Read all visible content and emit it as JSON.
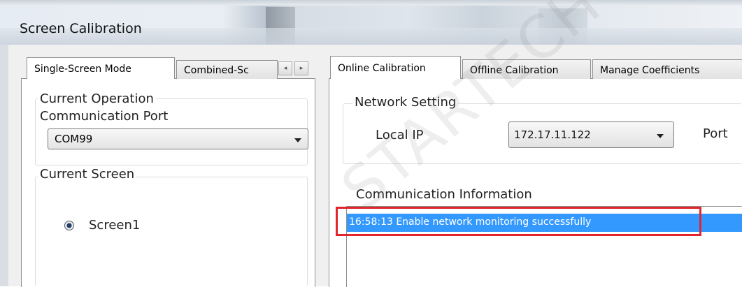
{
  "window": {
    "title": "Screen Calibration"
  },
  "left_tabs": [
    {
      "label": "Single-Screen Mode",
      "selected": true
    },
    {
      "label": "Combined-Sc",
      "selected": false
    }
  ],
  "tab_scroll": {
    "left_icon": "chevron-left-icon",
    "right_icon": "chevron-right-icon",
    "left_glyph": "◂",
    "right_glyph": "▸"
  },
  "current_operation": {
    "label_line1": "Current Operation",
    "label_line2": "Communication Port",
    "port_value": "COM99"
  },
  "current_screen": {
    "label": "Current Screen",
    "radio_label": "Screen1",
    "radio_selected": true
  },
  "right_tabs": [
    {
      "label": "Online Calibration",
      "selected": true
    },
    {
      "label": "Offline Calibration",
      "selected": false
    },
    {
      "label": "Manage Coefficients",
      "selected": false
    }
  ],
  "network_setting": {
    "label": "Network Setting",
    "local_ip_label": "Local IP",
    "local_ip_value": "172.17.11.122",
    "port_label": "Port"
  },
  "communication_info": {
    "label": "Communication Information",
    "messages": [
      "16:58:13  Enable network monitoring successfully"
    ]
  },
  "watermark_text": "STARTECH CO.,",
  "colors": {
    "selection": "#3399ff",
    "highlight_box": "#e0262c"
  }
}
